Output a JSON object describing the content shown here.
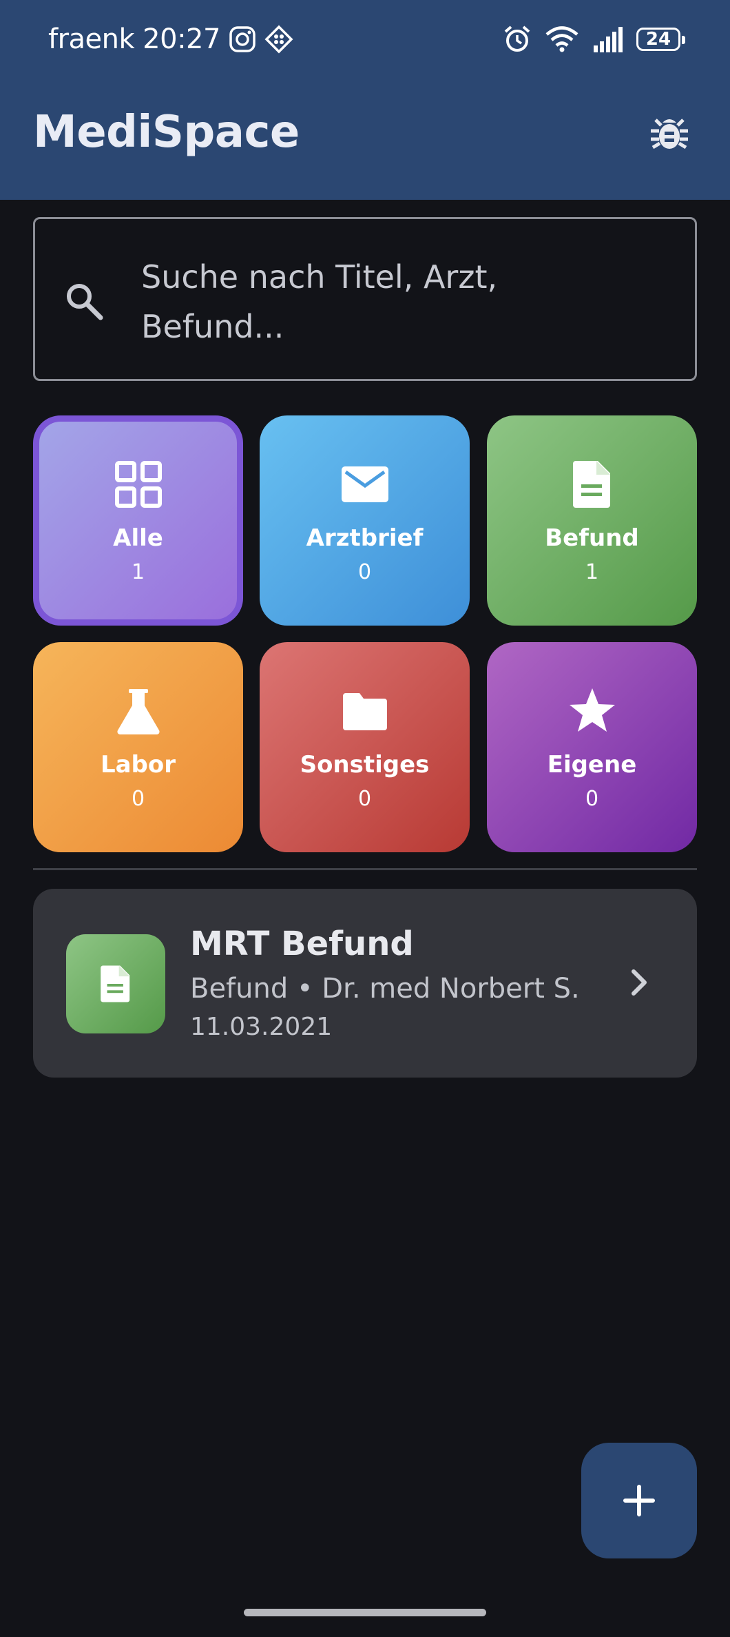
{
  "status_bar": {
    "carrier": "fraenk",
    "time": "20:27",
    "battery": "24"
  },
  "app": {
    "title": "MediSpace"
  },
  "search": {
    "placeholder": "Suche nach Titel, Arzt, Befund..."
  },
  "categories": [
    {
      "label": "Alle",
      "count": "1",
      "icon": "grid-icon",
      "selected": true
    },
    {
      "label": "Arztbrief",
      "count": "0",
      "icon": "envelope-icon"
    },
    {
      "label": "Befund",
      "count": "1",
      "icon": "document-icon"
    },
    {
      "label": "Labor",
      "count": "0",
      "icon": "flask-icon"
    },
    {
      "label": "Sonstiges",
      "count": "0",
      "icon": "folder-icon"
    },
    {
      "label": "Eigene",
      "count": "0",
      "icon": "star-icon"
    }
  ],
  "documents": [
    {
      "title": "MRT Befund",
      "subtitle": "Befund • Dr. med Norbert S.",
      "date": "11.03.2021",
      "icon": "document-icon"
    }
  ],
  "colors": {
    "appbar": "#2b4772",
    "background": "#121318",
    "card": "#33343a",
    "alle": "#9a6fdc",
    "arztbrief": "#3e8fd8",
    "befund": "#559a49",
    "labor": "#ec8a34",
    "sonstiges": "#b83a34",
    "eigene": "#7129a4"
  }
}
